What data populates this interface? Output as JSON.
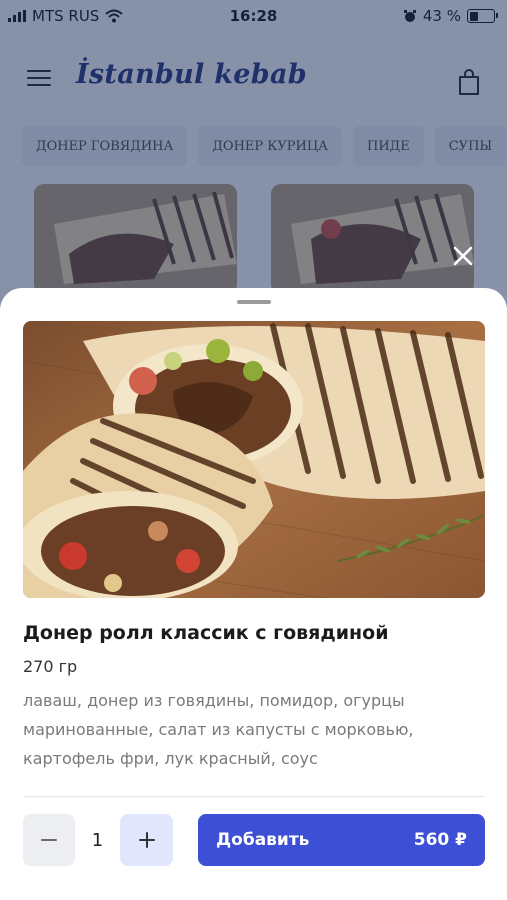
{
  "status_bar": {
    "carrier": "MTS RUS",
    "time": "16:28",
    "battery": "43 %",
    "battery_level": 0.43,
    "icons": [
      "signal-icon",
      "wifi-icon",
      "alarm-icon",
      "battery-icon"
    ]
  },
  "header": {
    "logo_text": "İstanbul kebab",
    "icons": [
      "menu-icon",
      "cart-icon"
    ]
  },
  "categories": [
    "ДОНЕР ГОВЯДИНА",
    "ДОНЕР КУРИЦА",
    "ПИДЕ",
    "СУПЫ"
  ],
  "product": {
    "title": "Донер ролл классик с говядиной",
    "weight": "270 гр",
    "description": "лаваш, донер из говядины, помидор, огурцы маринованные, салат из  капусты с морковью, картофель фри, лук красный, соус",
    "quantity": "1",
    "add_label": "Добавить",
    "price": "560 ₽"
  },
  "colors": {
    "accent": "#3d4fd4",
    "logo": "#22307a",
    "plus_bg": "#e2e6fd",
    "overlay": "#1c305c"
  }
}
